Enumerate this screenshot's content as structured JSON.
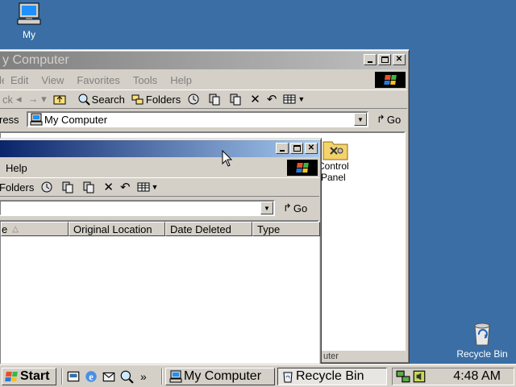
{
  "desktop": {
    "my_computer_label": "My",
    "recycle_bin_label": "Recycle Bin"
  },
  "back_window": {
    "title": "y Computer",
    "menu": [
      "Edit",
      "View",
      "Favorites",
      "Tools",
      "Help"
    ],
    "menu_left_fragment": "le",
    "toolbar": {
      "back_label": "ck",
      "search_label": "Search",
      "folders_label": "Folders"
    },
    "address": {
      "label": "ress",
      "value": "My Computer",
      "go_label": "Go"
    },
    "items": [
      {
        "label_line1": "Control",
        "label_line2": "Panel"
      }
    ],
    "status_fragment": "uter"
  },
  "front_window": {
    "menu": [
      "Help"
    ],
    "toolbar": {
      "folders_label": "Folders"
    },
    "address": {
      "value": "",
      "go_label": "Go"
    },
    "columns": [
      "e",
      "Original Location",
      "Date Deleted",
      "Type"
    ]
  },
  "taskbar": {
    "start_label": "Start",
    "overflow": "»",
    "tasks": [
      {
        "label": "My Computer",
        "pressed": false
      },
      {
        "label": "Recycle Bin",
        "pressed": true
      }
    ],
    "clock": "4:48 AM"
  },
  "colors": {
    "desktop": "#3a6ea5",
    "face": "#d4d0c8",
    "active_title_start": "#0a246a",
    "active_title_end": "#a6caf0",
    "inactive_title_start": "#808080",
    "inactive_title_end": "#c0c0c0"
  }
}
